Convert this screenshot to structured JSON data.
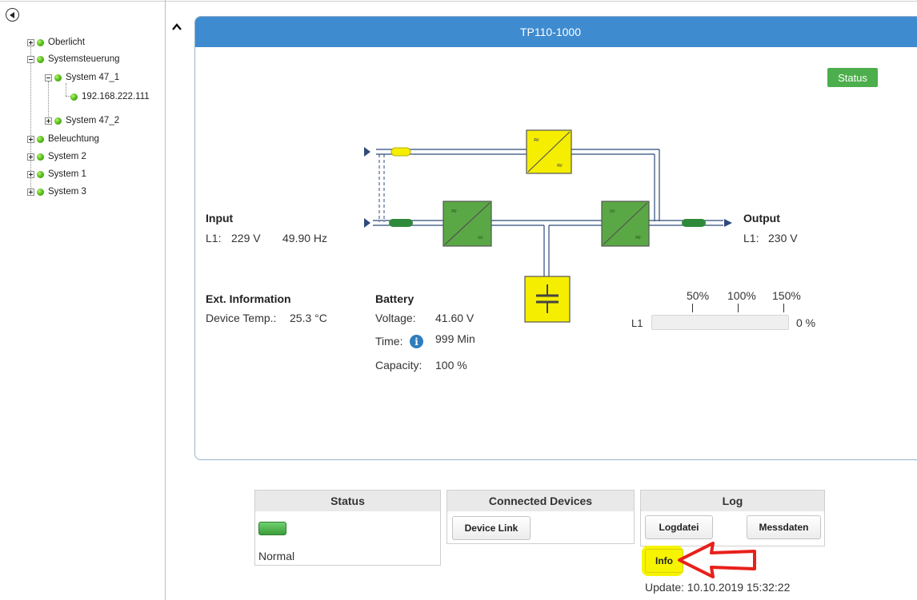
{
  "sidebar": {
    "tree": [
      {
        "label": "Oberlicht"
      },
      {
        "label": "Systemsteuerung"
      },
      {
        "label": "System 47_1"
      },
      {
        "label": "192.168.222.111"
      },
      {
        "label": "System 47_2"
      },
      {
        "label": "Beleuchtung"
      },
      {
        "label": "System 2"
      },
      {
        "label": "System 1"
      },
      {
        "label": "System 3"
      }
    ]
  },
  "panel": {
    "title": "TP110-1000",
    "status_button": "Status",
    "input": {
      "heading": "Input",
      "phase": "L1:",
      "voltage": "229 V",
      "frequency": "49.90 Hz"
    },
    "output": {
      "heading": "Output",
      "phase": "L1:",
      "voltage": "230 V"
    },
    "ext_info": {
      "heading": "Ext. Information",
      "label": "Device Temp.:",
      "value": "25.3 °C"
    },
    "battery": {
      "heading": "Battery",
      "voltage_label": "Voltage:",
      "voltage_value": "41.60 V",
      "time_label": "Time:",
      "time_value": "999 Min",
      "capacity_label": "Capacity:",
      "capacity_value": "100 %"
    },
    "load": {
      "phase": "L1",
      "value": "0 %",
      "fraction": 0.0,
      "ticks": [
        "50%",
        "100%",
        "150%"
      ]
    }
  },
  "status_box": {
    "title": "Status",
    "state": "Normal"
  },
  "devices_box": {
    "title": "Connected Devices",
    "button": "Device Link"
  },
  "log_box": {
    "title": "Log",
    "logfile_button": "Logdatei",
    "measure_button": "Messdaten",
    "info_button": "Info",
    "update_text": "Update: 10.10.2019 15:32:22"
  },
  "colors": {
    "header": "#3f8bd0",
    "status_green": "#4cae4c",
    "bypass_yellow": "#f5ee00",
    "converter_green": "#5aa845",
    "annotation_red": "#e8201c"
  },
  "icons": [
    "back-arrow-icon",
    "collapse-chevron-icon",
    "info-icon",
    "red-arrow-annotation"
  ]
}
